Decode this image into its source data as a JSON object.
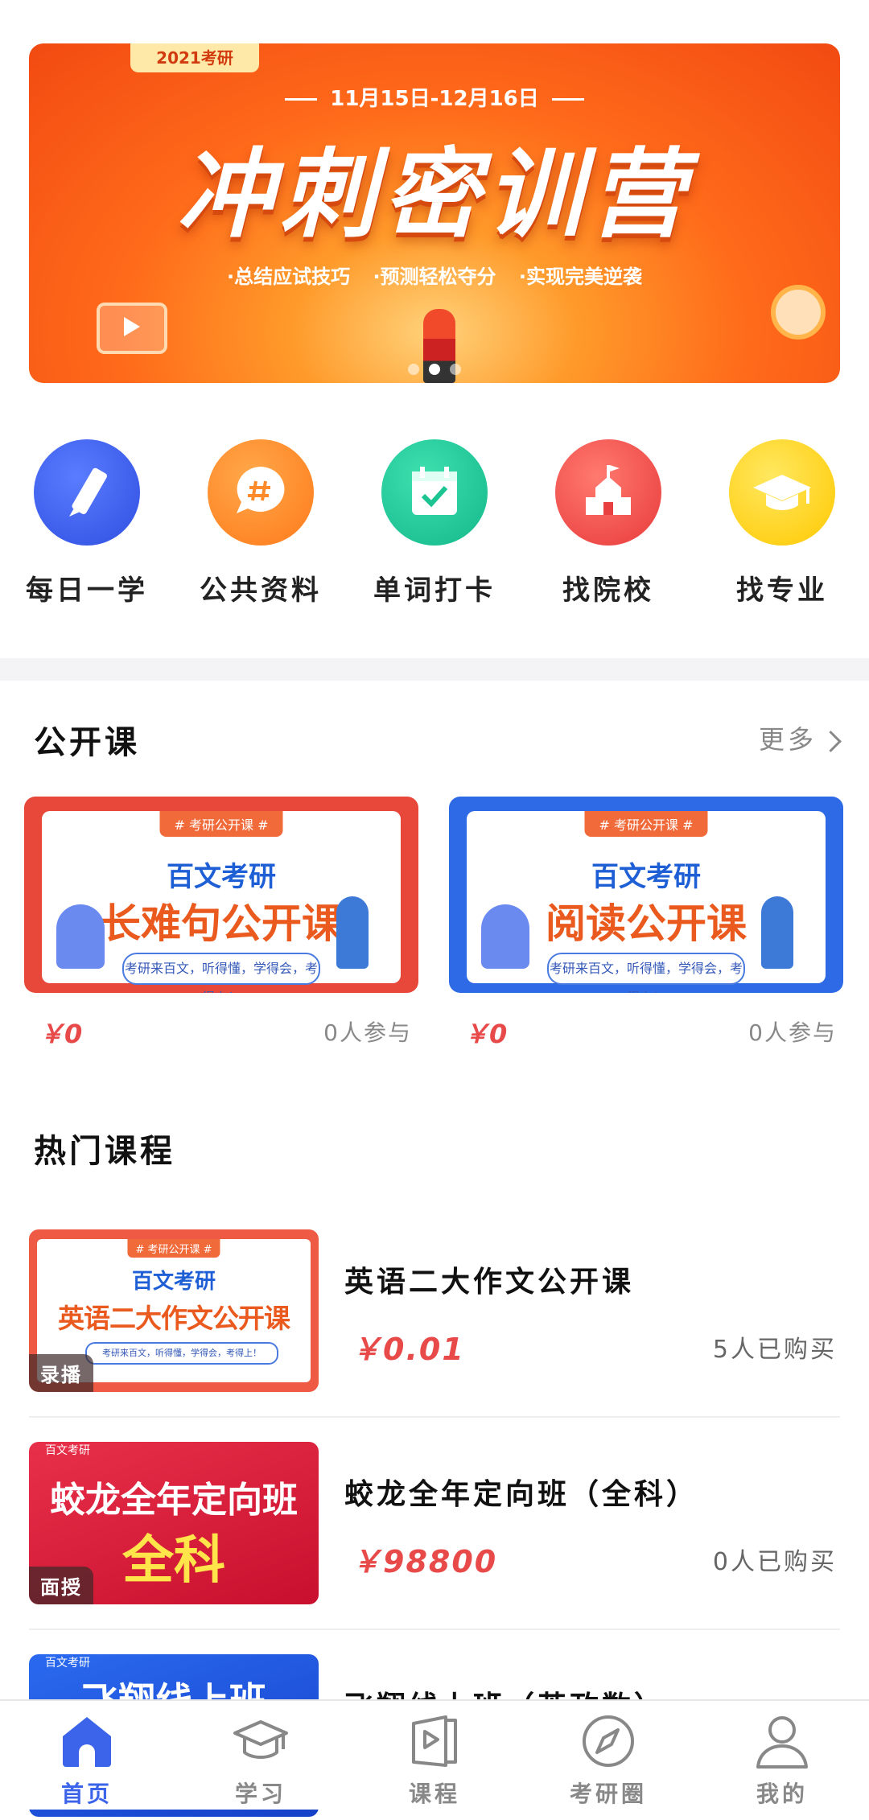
{
  "banner": {
    "year_tag": "2021考研",
    "dates": "11月15日-12月16日",
    "title": "冲刺密训营",
    "points": "·总结应试技巧  ·预测轻松夺分  ·实现完美逆袭",
    "dots": 3,
    "active_dot": 1
  },
  "quick_menu": [
    {
      "label": "每日一学",
      "icon": "pencil-icon",
      "color": "#3b5cf0"
    },
    {
      "label": "公共资料",
      "icon": "chat-hash-icon",
      "color": "#ff8a2a"
    },
    {
      "label": "单词打卡",
      "icon": "calendar-check-icon",
      "color": "#22c79a"
    },
    {
      "label": "找院校",
      "icon": "school-icon",
      "color": "#f0504a"
    },
    {
      "label": "找专业",
      "icon": "graduation-cap-icon",
      "color": "#ffd420"
    }
  ],
  "open_course": {
    "title": "公开课",
    "more": "更多",
    "cards": [
      {
        "tag": "# 考研公开课 #",
        "brand": "百文考研",
        "course": "长难句公开课",
        "slogan": "考研来百文，听得懂，学得会，考得上！",
        "price": "￥0",
        "count": "0人参与",
        "frame": "#e8483a"
      },
      {
        "tag": "# 考研公开课 #",
        "brand": "百文考研",
        "course": "阅读公开课",
        "slogan": "考研来百文，听得懂，学得会，考得上！",
        "price": "￥0",
        "count": "0人参与",
        "frame": "#2f6ae6"
      }
    ]
  },
  "hot_courses": {
    "title": "热门课程",
    "items": [
      {
        "title": "英语二大作文公开课",
        "price": "￥0.01",
        "buyers": "5人已购买",
        "badge": "录播",
        "thumb": {
          "tag": "# 考研公开课 #",
          "brand": "百文考研",
          "course": "英语二大作文公开课",
          "slogan": "考研来百文，听得懂，学得会，考得上！"
        }
      },
      {
        "title": "蛟龙全年定向班（全科）",
        "price": "￥98800",
        "buyers": "0人已购买",
        "badge": "面授",
        "thumb": {
          "small": "百文考研",
          "line1": "蛟龙全年定向班",
          "line2": "全科"
        }
      },
      {
        "title": "飞翔线上班（英政数）",
        "price": "",
        "buyers": "",
        "badge": "",
        "thumb": {
          "small": "百文考研",
          "line1": "飞翔线上班"
        }
      }
    ]
  },
  "bottom_nav": [
    {
      "label": "首页",
      "icon": "home-icon",
      "active": true
    },
    {
      "label": "学习",
      "icon": "mortarboard-icon",
      "active": false
    },
    {
      "label": "课程",
      "icon": "video-book-icon",
      "active": false
    },
    {
      "label": "考研圈",
      "icon": "compass-icon",
      "active": false
    },
    {
      "label": "我的",
      "icon": "user-icon",
      "active": false
    }
  ],
  "colors": {
    "accent": "#3b64ea",
    "price": "#e84a4a",
    "muted": "#888888"
  }
}
